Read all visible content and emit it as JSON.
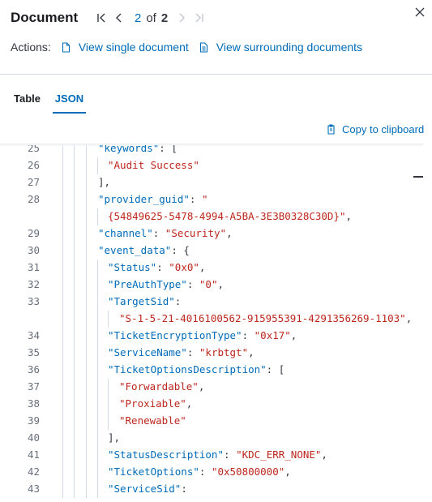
{
  "header": {
    "title": "Document",
    "pager": {
      "current": "2",
      "of": "of",
      "total": "2"
    }
  },
  "actions": {
    "label": "Actions:",
    "view_single": "View single document",
    "view_surrounding": "View surrounding documents"
  },
  "tabs": [
    {
      "label": "Table",
      "active": false
    },
    {
      "label": "JSON",
      "active": true
    }
  ],
  "copy_label": "Copy to clipboard",
  "colors": {
    "link": "#006bb8",
    "string": "#bd271e",
    "text": "#343741",
    "line_number": "#69707d"
  },
  "code_lines": [
    {
      "num": "25",
      "parts": [
        [
          "key",
          "\"keywords\""
        ],
        [
          "pun",
          ": ["
        ]
      ]
    },
    {
      "num": "26",
      "parts": [
        [
          "str",
          "\"Audit Success\""
        ]
      ]
    },
    {
      "num": "27",
      "parts": [
        [
          "pun",
          "],"
        ]
      ]
    },
    {
      "num": "28",
      "parts": [
        [
          "key",
          "\"provider_guid\""
        ],
        [
          "pun",
          ": "
        ],
        [
          "str",
          "\""
        ]
      ]
    },
    {
      "num": "",
      "parts": [
        [
          "str",
          "{54849625-5478-4994-A5BA-3E3B0328C30D}\""
        ],
        [
          "pun",
          ","
        ]
      ]
    },
    {
      "num": "29",
      "parts": [
        [
          "key",
          "\"channel\""
        ],
        [
          "pun",
          ": "
        ],
        [
          "str",
          "\"Security\""
        ],
        [
          "pun",
          ","
        ]
      ]
    },
    {
      "num": "30",
      "parts": [
        [
          "key",
          "\"event_data\""
        ],
        [
          "pun",
          ": {"
        ]
      ]
    },
    {
      "num": "31",
      "parts": [
        [
          "key",
          "\"Status\""
        ],
        [
          "pun",
          ": "
        ],
        [
          "str",
          "\"0x0\""
        ],
        [
          "pun",
          ","
        ]
      ]
    },
    {
      "num": "32",
      "parts": [
        [
          "key",
          "\"PreAuthType\""
        ],
        [
          "pun",
          ": "
        ],
        [
          "str",
          "\"0\""
        ],
        [
          "pun",
          ","
        ]
      ]
    },
    {
      "num": "33",
      "parts": [
        [
          "key",
          "\"TargetSid\""
        ],
        [
          "pun",
          ":"
        ]
      ]
    },
    {
      "num": "",
      "parts": [
        [
          "str",
          "\"S-1-5-21-4016100562-915955391-4291356269-1103\""
        ],
        [
          "pun",
          ","
        ]
      ]
    },
    {
      "num": "34",
      "parts": [
        [
          "key",
          "\"TicketEncryptionType\""
        ],
        [
          "pun",
          ": "
        ],
        [
          "str",
          "\"0x17\""
        ],
        [
          "pun",
          ","
        ]
      ]
    },
    {
      "num": "35",
      "parts": [
        [
          "key",
          "\"ServiceName\""
        ],
        [
          "pun",
          ": "
        ],
        [
          "str",
          "\"krbtgt\""
        ],
        [
          "pun",
          ","
        ]
      ]
    },
    {
      "num": "36",
      "parts": [
        [
          "key",
          "\"TicketOptionsDescription\""
        ],
        [
          "pun",
          ": ["
        ]
      ]
    },
    {
      "num": "37",
      "parts": [
        [
          "str",
          "\"Forwardable\""
        ],
        [
          "pun",
          ","
        ]
      ]
    },
    {
      "num": "38",
      "parts": [
        [
          "str",
          "\"Proxiable\""
        ],
        [
          "pun",
          ","
        ]
      ]
    },
    {
      "num": "39",
      "parts": [
        [
          "str",
          "\"Renewable\""
        ]
      ]
    },
    {
      "num": "40",
      "parts": [
        [
          "pun",
          "],"
        ]
      ]
    },
    {
      "num": "41",
      "parts": [
        [
          "key",
          "\"StatusDescription\""
        ],
        [
          "pun",
          ": "
        ],
        [
          "str",
          "\"KDC_ERR_NONE\""
        ],
        [
          "pun",
          ","
        ]
      ]
    },
    {
      "num": "42",
      "parts": [
        [
          "key",
          "\"TicketOptions\""
        ],
        [
          "pun",
          ": "
        ],
        [
          "str",
          "\"0x50800000\""
        ],
        [
          "pun",
          ","
        ]
      ]
    },
    {
      "num": "43",
      "parts": [
        [
          "key",
          "\"ServiceSid\""
        ],
        [
          "pun",
          ":"
        ]
      ]
    }
  ]
}
